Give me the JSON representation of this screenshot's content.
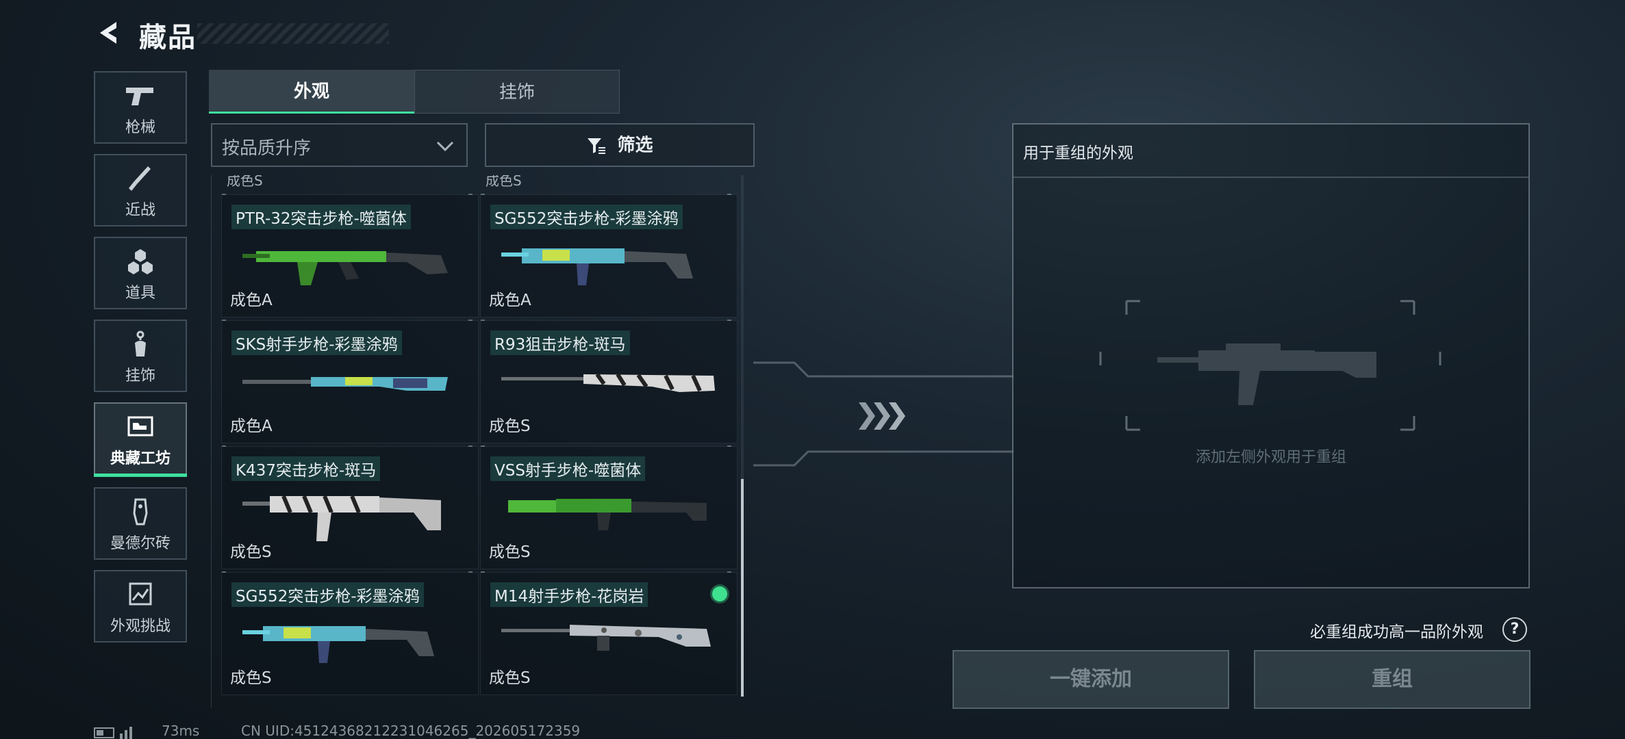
{
  "header": {
    "title": "藏品"
  },
  "categories": [
    {
      "label": "枪械",
      "icon": "pistol-icon"
    },
    {
      "label": "近战",
      "icon": "knife-icon"
    },
    {
      "label": "道具",
      "icon": "grenade-icon"
    },
    {
      "label": "挂饰",
      "icon": "charm-icon"
    },
    {
      "label": "典藏工坊",
      "icon": "workshop-icon",
      "active": true
    },
    {
      "label": "曼德尔砖",
      "icon": "mandel-brick-icon"
    },
    {
      "label": "外观挑战",
      "icon": "challenge-icon"
    }
  ],
  "tabs": [
    {
      "label": "外观",
      "active": true
    },
    {
      "label": "挂饰"
    }
  ],
  "sort": {
    "label": "按品质升序"
  },
  "filter": {
    "label": "筛选"
  },
  "peek": {
    "left": "成色S",
    "right": "成色S"
  },
  "items": [
    {
      "name": "PTR-32突击步枪-噬菌体",
      "grade": "成色A",
      "skin": "green"
    },
    {
      "name": "SG552突击步枪-彩墨涂鸦",
      "grade": "成色A",
      "skin": "graffiti"
    },
    {
      "name": "SKS射手步枪-彩墨涂鸦",
      "grade": "成色A",
      "skin": "graffiti"
    },
    {
      "name": "R93狙击步枪-斑马",
      "grade": "成色S",
      "skin": "zebra"
    },
    {
      "name": "K437突击步枪-斑马",
      "grade": "成色S",
      "skin": "zebra"
    },
    {
      "name": "VSS射手步枪-噬菌体",
      "grade": "成色S",
      "skin": "green"
    },
    {
      "name": "SG552突击步枪-彩墨涂鸦",
      "grade": "成色S",
      "skin": "graffiti"
    },
    {
      "name": "M14射手步枪-花岗岩",
      "grade": "成色S",
      "skin": "granite",
      "selected": true
    }
  ],
  "panel": {
    "title": "用于重组的外观",
    "hint": "添加左侧外观用于重组"
  },
  "guarantee": {
    "text": "必重组成功高一品阶外观",
    "help": "?"
  },
  "buttons": {
    "add": "一键添加",
    "recombine": "重组"
  },
  "footer": {
    "ping": "73ms",
    "uid": "CN UID:451243682122310462​65_202605172359"
  },
  "colors": {
    "accent": "#3fe0a0",
    "selected": "#3fe08f"
  }
}
